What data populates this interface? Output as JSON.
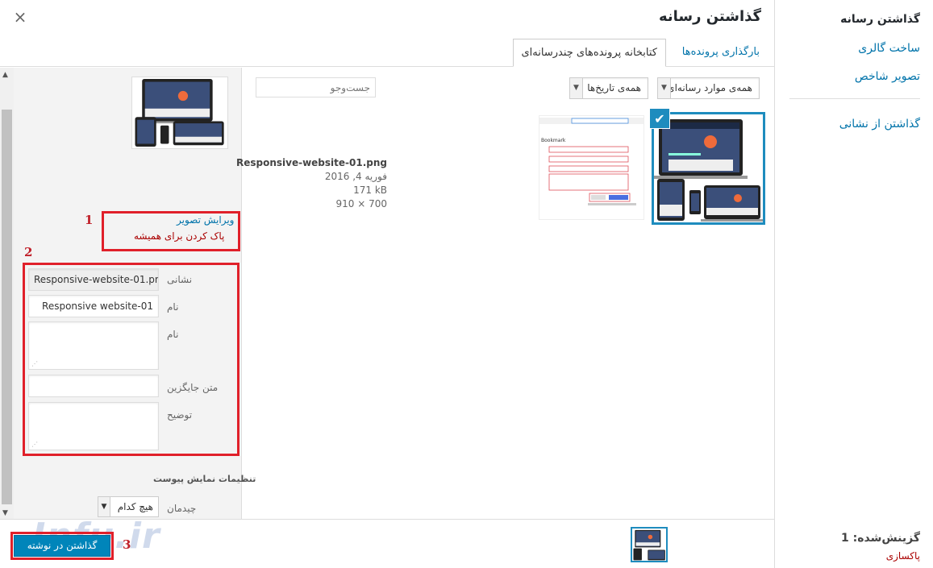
{
  "menu": {
    "title": "گذاشتن رسانه",
    "items": [
      "ساخت گالری",
      "تصویر شاخص",
      "گذاشتن از نشانی"
    ]
  },
  "frame": {
    "title": "گذاشتن رسانه",
    "close": "×"
  },
  "tabs": {
    "upload": "بارگذاری پرونده‌ها",
    "library": "کتابخانه پرونده‌های چندرسانه‌ای"
  },
  "toolbar": {
    "type_filter": "همه‌ی موارد رسانه‌ای",
    "date_filter": "همه‌ی تاریخ‌ها",
    "search_placeholder": "جست‌وجو"
  },
  "details": {
    "filename": "Responsive-website-01.png",
    "date": "فوریه 4, 2016",
    "size": "171 kB",
    "dimensions": "910 × 700",
    "edit": "ویرایش تصویر",
    "delete": "پاک کردن برای همیشه"
  },
  "fields": {
    "url_label": "نشانی",
    "url_value": "Responsive-website-01.png",
    "title_label": "نام",
    "title_value": "Responsive website-01",
    "caption_label": "نام",
    "alt_label": "متن جایگزین",
    "desc_label": "توضیح"
  },
  "display_settings": {
    "title": "تنظیمات نمایش پیوست",
    "align_label": "چیدمان",
    "align_value": "هیچ کدام"
  },
  "footer": {
    "selected": "گزینش‌شده: 1",
    "clear": "پاکسازی",
    "insert": "گذاشتن در نوشته"
  },
  "annotations": [
    "1",
    "2",
    "3"
  ],
  "thumb2": {
    "bookmark": "Bookmark"
  },
  "watermark": "Infu.ir",
  "colors": {
    "accent": "#0073aa",
    "primary_button": "#0085ba",
    "selected_border": "#1e8cbe",
    "annotation_red": "#e0202a",
    "danger": "#a00"
  }
}
